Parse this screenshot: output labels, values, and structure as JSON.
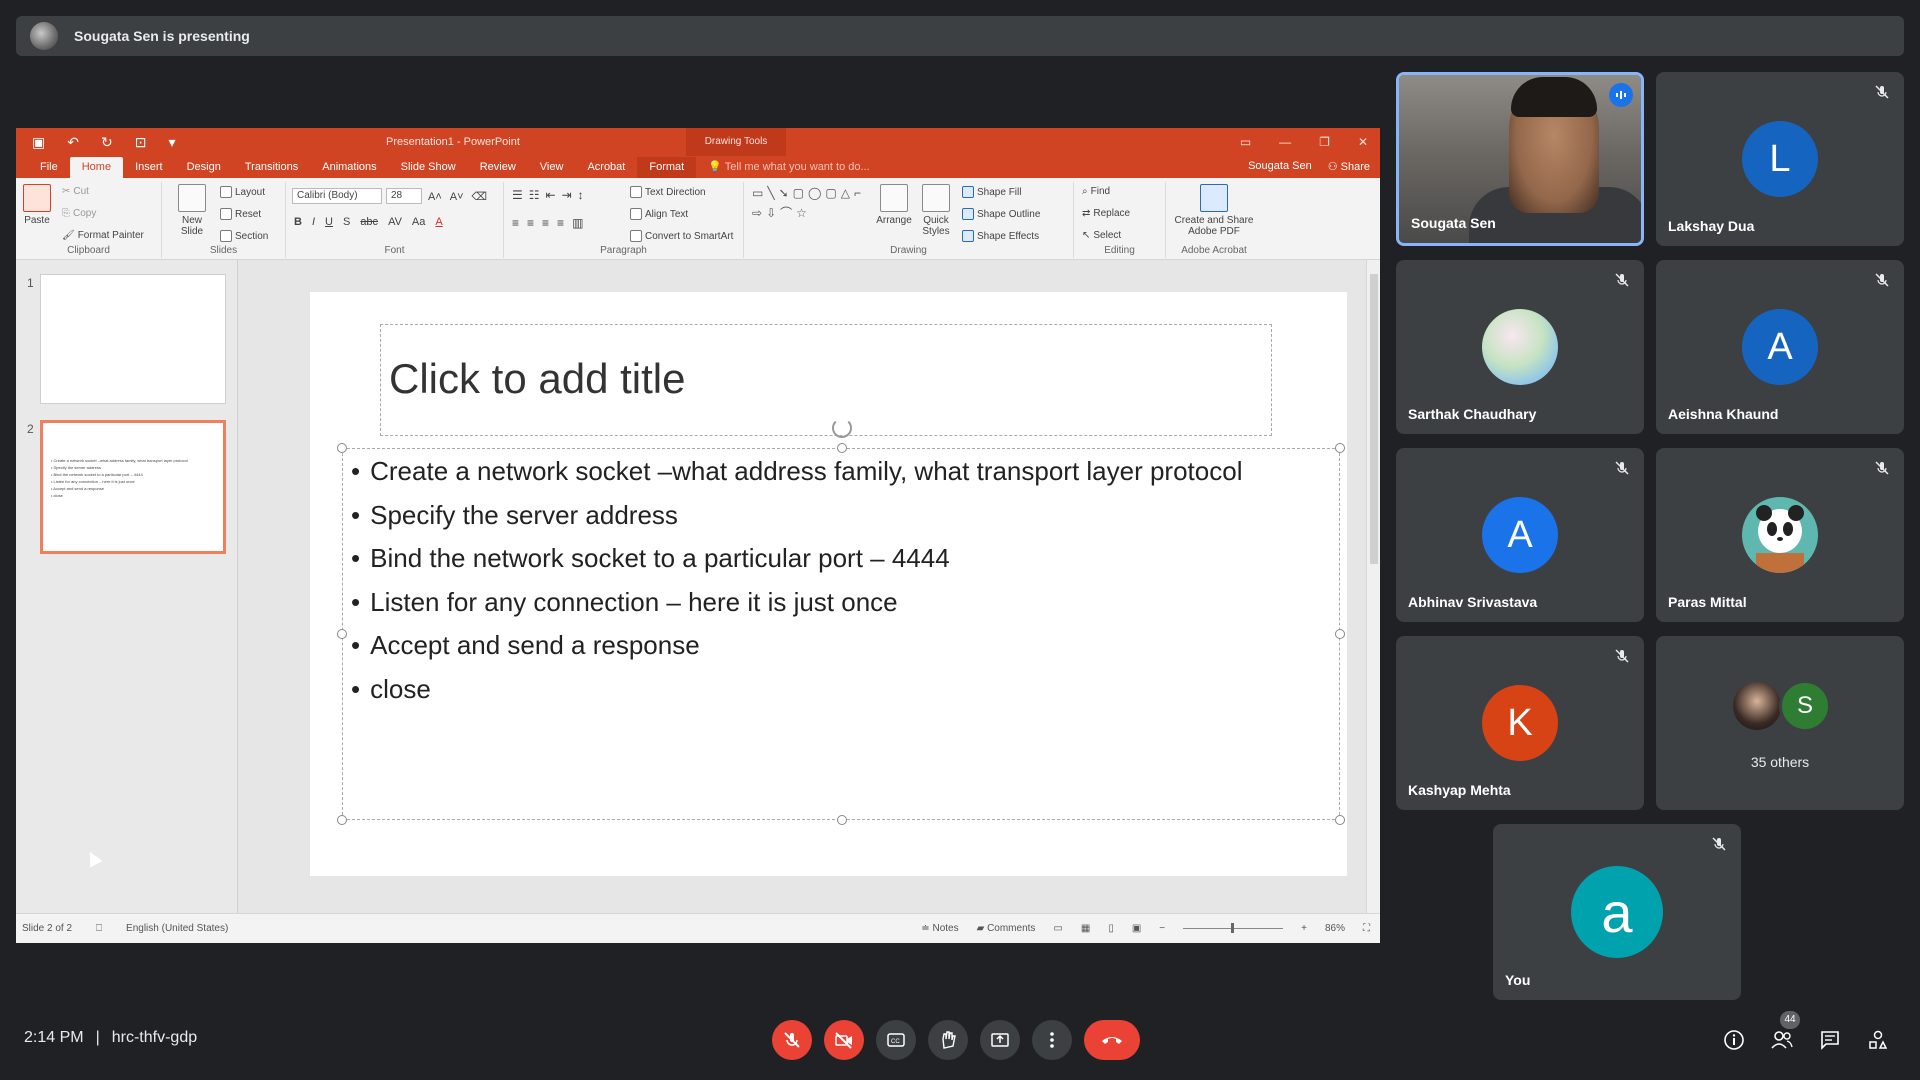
{
  "presenting": {
    "text": "Sougata Sen is presenting"
  },
  "ppt": {
    "qat_icons": [
      "save-icon",
      "undo-icon",
      "redo-icon",
      "present-icon",
      "customize-icon"
    ],
    "doc_title": "Presentation1 - PowerPoint",
    "drawing_tools": "Drawing Tools",
    "tabs": [
      "File",
      "Home",
      "Insert",
      "Design",
      "Transitions",
      "Animations",
      "Slide Show",
      "Review",
      "View",
      "Acrobat",
      "Format"
    ],
    "active_tab": "Home",
    "tell_me": "Tell me what you want to do...",
    "user": "Sougata Sen",
    "share": "Share",
    "ribbon": {
      "clipboard": {
        "label": "Clipboard",
        "paste": "Paste",
        "cut": "Cut",
        "copy": "Copy",
        "format_painter": "Format Painter"
      },
      "slides": {
        "label": "Slides",
        "new_slide": "New Slide",
        "layout": "Layout",
        "reset": "Reset",
        "section": "Section"
      },
      "font": {
        "label": "Font",
        "font_name": "Calibri (Body)",
        "font_size": "28",
        "bold": "B",
        "italic": "I",
        "underline": "U",
        "shadow": "S",
        "strike": "abc",
        "spacing": "AV",
        "case": "Aa",
        "color": "A"
      },
      "paragraph": {
        "label": "Paragraph",
        "text_direction": "Text Direction",
        "align_text": "Align Text",
        "convert_smartart": "Convert to SmartArt"
      },
      "drawing": {
        "label": "Drawing",
        "arrange": "Arrange",
        "quick_styles": "Quick Styles",
        "shape_fill": "Shape Fill",
        "shape_outline": "Shape Outline",
        "shape_effects": "Shape Effects"
      },
      "editing": {
        "label": "Editing",
        "find": "Find",
        "replace": "Replace",
        "select": "Select"
      },
      "acrobat": {
        "label": "Adobe Acrobat",
        "create_share": "Create and Share",
        "adobe_pdf": "Adobe PDF"
      }
    },
    "thumbnails": [
      {
        "num": "1",
        "lines": []
      },
      {
        "num": "2",
        "lines": [
          "• Create a network socket –what address family, what transport layer protocol",
          "• Specify the server address",
          "• Bind the network socket to a particular port – 4444",
          "• Listen for any connection – here it is just once",
          "• Accept and send a response",
          "• close"
        ]
      }
    ],
    "slide": {
      "title_placeholder": "Click to add title",
      "bullets": [
        "Create a network socket –what address family, what transport layer protocol",
        "Specify the server address",
        "Bind the network socket to a particular port – 4444",
        "Listen for any connection – here it is just once",
        "Accept and send a response",
        "close"
      ]
    },
    "status": {
      "slide_of": "Slide 2 of 2",
      "language": "English (United States)",
      "notes": "Notes",
      "comments": "Comments",
      "zoom": "86%"
    }
  },
  "participants": [
    {
      "name": "Sougata Sen",
      "type": "video",
      "speaking": true
    },
    {
      "name": "Lakshay Dua",
      "initial": "L",
      "color": "#1565c0",
      "muted": true
    },
    {
      "name": "Sarthak Chaudhary",
      "type": "image",
      "muted": true
    },
    {
      "name": "Aeishna Khaund",
      "initial": "A",
      "color": "#1565c0",
      "muted": true
    },
    {
      "name": "Abhinav Srivastava",
      "initial": "A",
      "color": "#1a73e8",
      "muted": true
    },
    {
      "name": "Paras Mittal",
      "type": "image",
      "muted": true
    },
    {
      "name": "Kashyap Mehta",
      "initial": "K",
      "color": "#d84315",
      "muted": true
    },
    {
      "others_label": "35 others",
      "others_initial": "S",
      "others_color": "#2e7d32"
    },
    {
      "name": "You",
      "initial": "a",
      "color": "#00a2ad",
      "muted": true
    }
  ],
  "bottom": {
    "time": "2:14 PM",
    "separator": "|",
    "meeting_code": "hrc-thfv-gdp",
    "people_count": "44",
    "controls": [
      "mic-off-icon",
      "camera-off-icon",
      "captions-icon",
      "raise-hand-icon",
      "present-screen-icon",
      "more-options-icon",
      "hang-up-icon"
    ],
    "right_controls": [
      "info-icon",
      "people-icon",
      "chat-icon",
      "activities-icon"
    ]
  }
}
